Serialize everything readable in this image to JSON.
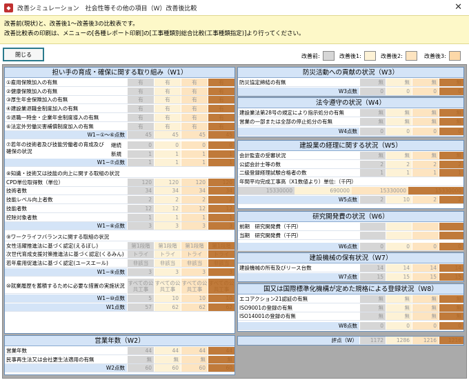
{
  "window": {
    "title": "改善シミュレーション　社会性等その他の項目（W）改善後比較"
  },
  "info": {
    "line1": "改善前(現状)と、改善後1〜改善後3の比較表です。",
    "line2": "改善比較表の印刷は、メニューの[各種レポート印刷]の[工事種類別総合比較(工事種類指定)]より行ってください。"
  },
  "close_button": "閉じる",
  "legend": {
    "before": "改善前:",
    "after1": "改善後1:",
    "after2": "改善後2:",
    "after3": "改善後3:"
  },
  "colors": {
    "before": "#d6d6d6",
    "after1": "#fdf2d6",
    "after2": "#fde4c0",
    "after3": "#c07a3a"
  },
  "w1": {
    "title": "担い手の育成・確保に関する取り組み（W1）",
    "rows": [
      {
        "label": "①雇用保険加入の有無",
        "v": [
          "有",
          "有",
          "有",
          "有"
        ]
      },
      {
        "label": "②健康保険加入の有無",
        "v": [
          "有",
          "有",
          "有",
          "有"
        ]
      },
      {
        "label": "③厚生年金保険加入の有無",
        "v": [
          "有",
          "有",
          "有",
          "有"
        ]
      },
      {
        "label": "④建設業退職金制度加入の有無",
        "v": [
          "有",
          "有",
          "有",
          "有"
        ]
      },
      {
        "label": "⑤退職一時金・企業年金制度導入の有無",
        "v": [
          "有",
          "有",
          "有",
          "有"
        ]
      },
      {
        "label": "⑥法定外労働災害補償制度加入の有無",
        "v": [
          "有",
          "有",
          "有",
          "有"
        ]
      }
    ],
    "sum16": {
      "label": "W1−①〜⑥点数",
      "v": [
        "45",
        "45",
        "45",
        "45"
      ]
    },
    "wakate_label": "⑦若年の技術者及び技能労働者の育成及び確保の状況",
    "wakate_rows": [
      {
        "label": "継続",
        "v": [
          "0",
          "0",
          "0",
          "0"
        ]
      },
      {
        "label": "新規",
        "v": [
          "1",
          "1",
          "1",
          "1"
        ]
      }
    ],
    "sum7": {
      "label": "W1−⑦点数",
      "v": [
        "1",
        "1",
        "1",
        "1"
      ]
    },
    "knowledge_title": "⑧知識・技術又は技能の向上に関する取組の状況",
    "knowledge_rows": [
      {
        "label": "CPD単位取得数（単位）",
        "v": [
          "120",
          "120",
          "120",
          "120"
        ]
      },
      {
        "label": "技術者数",
        "v": [
          "34",
          "34",
          "34",
          "34"
        ]
      },
      {
        "label": "技能レベル向上者数",
        "v": [
          "2",
          "2",
          "2",
          "2"
        ]
      },
      {
        "label": "技能者数",
        "v": [
          "12",
          "12",
          "12",
          "12"
        ]
      },
      {
        "label": "控除対象者数",
        "v": [
          "1",
          "1",
          "1",
          "1"
        ]
      }
    ],
    "sum8": {
      "label": "W1−⑧点数",
      "v": [
        "3",
        "3",
        "3",
        "3"
      ]
    },
    "wlb_title": "⑨ワークライフバランスに関する取組の状況",
    "wlb_rows": [
      {
        "label": "女性活躍推進法に基づく認定(えるぼし)",
        "v": [
          "第1段階",
          "第1段階",
          "第1段階",
          "第1段階"
        ]
      },
      {
        "label": "次世代育成支援対策推進法に基づく認定(くるみん)",
        "v": [
          "トライ",
          "トライ",
          "トライ",
          "トライ"
        ]
      },
      {
        "label": "若年雇用促進法に基づく認定(ユースエール)",
        "v": [
          "非該当",
          "非該当",
          "非該当",
          "非該当"
        ]
      }
    ],
    "sum9": {
      "label": "W1−⑨点数",
      "v": [
        "3",
        "3",
        "3",
        "3"
      ]
    },
    "career_label": "⑩就業履歴を蓄積するために必要な措置の実施状況",
    "career_v": [
      "すべての公共工事",
      "すべての公共工事",
      "すべての公共工事",
      "すべての公共工事"
    ],
    "sum10": {
      "label": "W1−⑩点数",
      "v": [
        "5",
        "10",
        "10",
        "10"
      ]
    },
    "total": {
      "label": "W1点数",
      "v": [
        "57",
        "62",
        "62",
        "62"
      ]
    }
  },
  "w2": {
    "title": "営業年数（W2）",
    "rows": [
      {
        "label": "営業年数",
        "v": [
          "44",
          "44",
          "44",
          "44"
        ]
      },
      {
        "label": "民事再生法又は会社更生法適用の有無",
        "v": [
          "無",
          "無",
          "無",
          "無"
        ]
      }
    ],
    "total": {
      "label": "W2点数",
      "v": [
        "60",
        "60",
        "60",
        "60"
      ]
    }
  },
  "w3": {
    "title": "防災活動への貢献の状況（W3）",
    "rows": [
      {
        "label": "防災協定締結の有無",
        "v": [
          "無",
          "無",
          "無",
          "無"
        ]
      }
    ],
    "total": {
      "label": "W3点数",
      "v": [
        "0",
        "0",
        "0",
        "0"
      ]
    }
  },
  "w4": {
    "title": "法令遵守の状況（W4）",
    "rows": [
      {
        "label": "建設業法第28号の規定により指示処分の有無",
        "v": [
          "無",
          "無",
          "無",
          "無"
        ]
      },
      {
        "label": "営業の一部または全部の停止処分の有無",
        "v": [
          "無",
          "無",
          "無",
          "無"
        ]
      }
    ],
    "total": {
      "label": "W4点数",
      "v": [
        "0",
        "0",
        "0",
        "0"
      ]
    }
  },
  "w5": {
    "title": "建設業の経理に関する状況（W5）",
    "rows": [
      {
        "label": "会計監査の受審状況",
        "v": [
          "無",
          "無",
          "無",
          "無"
        ]
      },
      {
        "label": "公認会計士等の数",
        "v": [
          "2",
          "2",
          "2",
          "2"
        ]
      },
      {
        "label": "二級登録経理試験合格者の数",
        "v": [
          "1",
          "1",
          "1",
          "1"
        ]
      }
    ],
    "avg_label": "年間平均完成工事高（X1数値より）単位:（千円）",
    "avg_v": [
      "15330000",
      "690000",
      "15330000",
      "15330000"
    ],
    "total": {
      "label": "W5点数",
      "v": [
        "2",
        "10",
        "2",
        "2"
      ]
    }
  },
  "w6": {
    "title": "研究開発費の状況（W6）",
    "rows": [
      {
        "label": "前期　研究開発費（千円）",
        "v": [
          "",
          "",
          "",
          ""
        ]
      },
      {
        "label": "当期　研究開発費（千円）",
        "v": [
          "",
          "",
          "",
          ""
        ]
      }
    ],
    "total": {
      "label": "W6点数",
      "v": [
        "0",
        "0",
        "0",
        "0"
      ]
    }
  },
  "w7": {
    "title": "建設機械の保有状況（W7）",
    "rows": [
      {
        "label": "建設機械の所有及びリース台数",
        "v": [
          "14",
          "14",
          "14",
          "14"
        ]
      }
    ],
    "total": {
      "label": "W7点数",
      "v": [
        "15",
        "15",
        "15",
        "15"
      ]
    }
  },
  "w8": {
    "title": "国又は国際標準化機構が定めた規格による登録状況（W8）",
    "rows": [
      {
        "label": "エコアクション21認証の有無",
        "v": [
          "無",
          "無",
          "無",
          "無"
        ]
      },
      {
        "label": "ISO9001の登録の有無",
        "v": [
          "無",
          "無",
          "無",
          "無"
        ]
      },
      {
        "label": "ISO14001の登録の有無",
        "v": [
          "無",
          "無",
          "無",
          "無"
        ]
      }
    ],
    "total": {
      "label": "W8点数",
      "v": [
        "0",
        "0",
        "0",
        "0"
      ]
    }
  },
  "score": {
    "label": "評点（W）",
    "v": [
      "1172",
      "1286",
      "1216",
      "1216"
    ]
  }
}
